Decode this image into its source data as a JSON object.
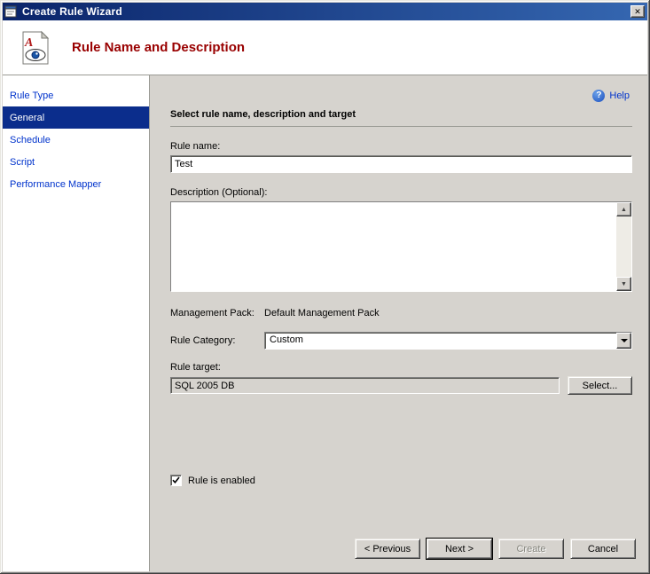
{
  "window": {
    "title": "Create Rule Wizard"
  },
  "header": {
    "title": "Rule Name and Description"
  },
  "sidebar": {
    "items": [
      {
        "label": "Rule Type",
        "active": false
      },
      {
        "label": "General",
        "active": true
      },
      {
        "label": "Schedule",
        "active": false
      },
      {
        "label": "Script",
        "active": false
      },
      {
        "label": "Performance Mapper",
        "active": false
      }
    ]
  },
  "content": {
    "help_label": "Help",
    "section_title": "Select rule name, description and target",
    "rule_name": {
      "label": "Rule name:",
      "value": "Test"
    },
    "description": {
      "label": "Description (Optional):",
      "value": ""
    },
    "management_pack": {
      "label": "Management Pack:",
      "value": "Default Management Pack"
    },
    "rule_category": {
      "label": "Rule Category:",
      "value": "Custom"
    },
    "rule_target": {
      "label": "Rule target:",
      "value": "SQL 2005 DB",
      "select_button": "Select..."
    },
    "rule_enabled": {
      "label": "Rule is enabled",
      "checked": true
    }
  },
  "footer": {
    "previous": "< Previous",
    "next": "Next >",
    "create": "Create",
    "cancel": "Cancel"
  },
  "colors": {
    "titlebar_start": "#0A246A",
    "titlebar_end": "#3567B1",
    "active_step_bg": "#0B2D8C",
    "link_blue": "#0033CC",
    "heading_red": "#990000",
    "window_bg": "#D6D3CE"
  }
}
